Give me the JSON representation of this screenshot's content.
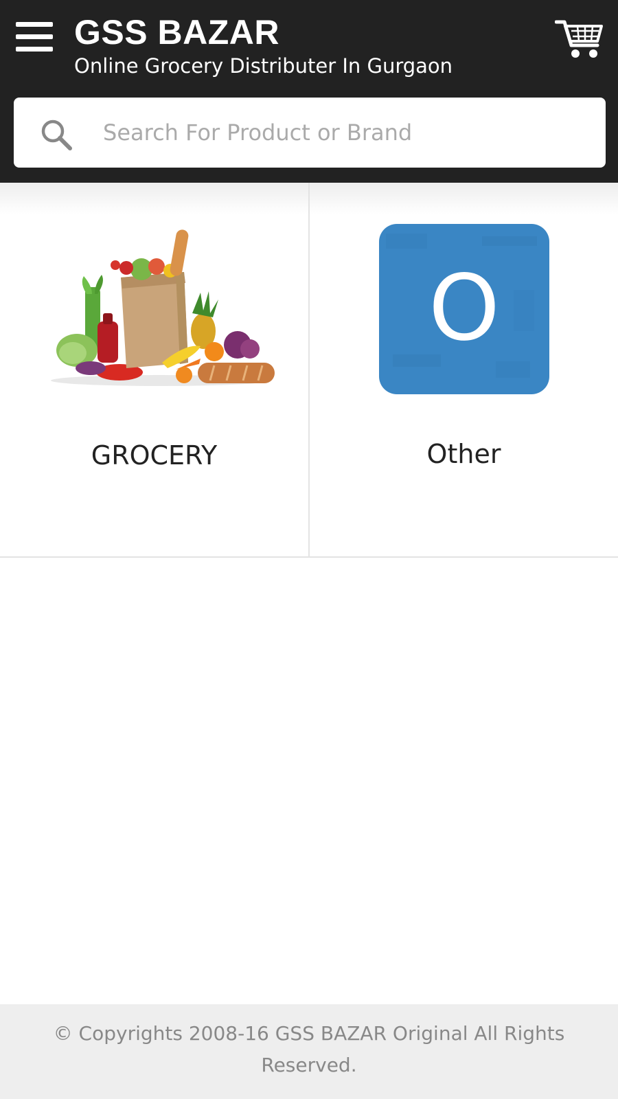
{
  "header": {
    "title": "GSS BAZAR",
    "subtitle": "Online Grocery Distributer In Gurgaon",
    "menu_icon": "hamburger-menu-icon",
    "cart_icon": "shopping-cart-icon",
    "background_color": "#222222"
  },
  "search": {
    "placeholder": "Search For Product or Brand",
    "value": "",
    "icon": "search-icon"
  },
  "categories": [
    {
      "label": "GROCERY",
      "image": "grocery-bag-image"
    },
    {
      "label": "Other",
      "image": "other-letter-o-image",
      "image_letter": "O",
      "image_color": "#3a86c4"
    }
  ],
  "footer": {
    "text": "© Copyrights 2008-16 GSS BAZAR Original All Rights Reserved."
  }
}
